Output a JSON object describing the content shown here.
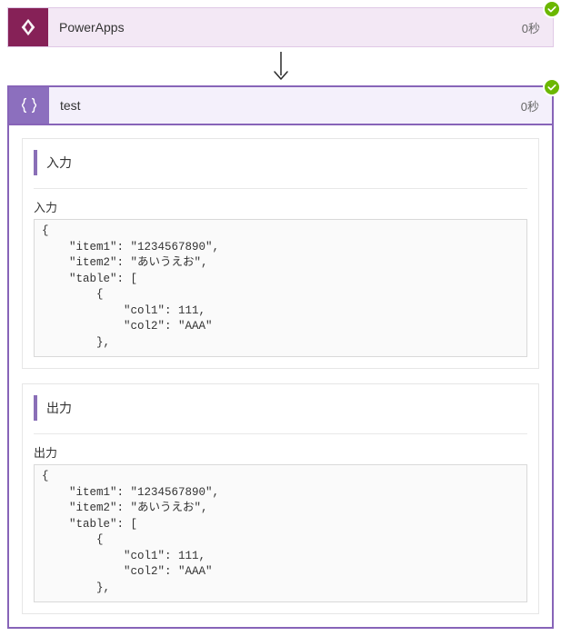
{
  "step1": {
    "title": "PowerApps",
    "duration": "0秒",
    "status": "success"
  },
  "step2": {
    "title": "test",
    "duration": "0秒",
    "status": "success",
    "inputs": {
      "header": "入力",
      "label": "入力",
      "body": "{\n    \"item1\": \"1234567890\",\n    \"item2\": \"あいうえお\",\n    \"table\": [\n        {\n            \"col1\": 111,\n            \"col2\": \"AAA\"\n        },"
    },
    "outputs": {
      "header": "出力",
      "label": "出力",
      "body": "{\n    \"item1\": \"1234567890\",\n    \"item2\": \"あいうえお\",\n    \"table\": [\n        {\n            \"col1\": 111,\n            \"col2\": \"AAA\"\n        },"
    }
  }
}
